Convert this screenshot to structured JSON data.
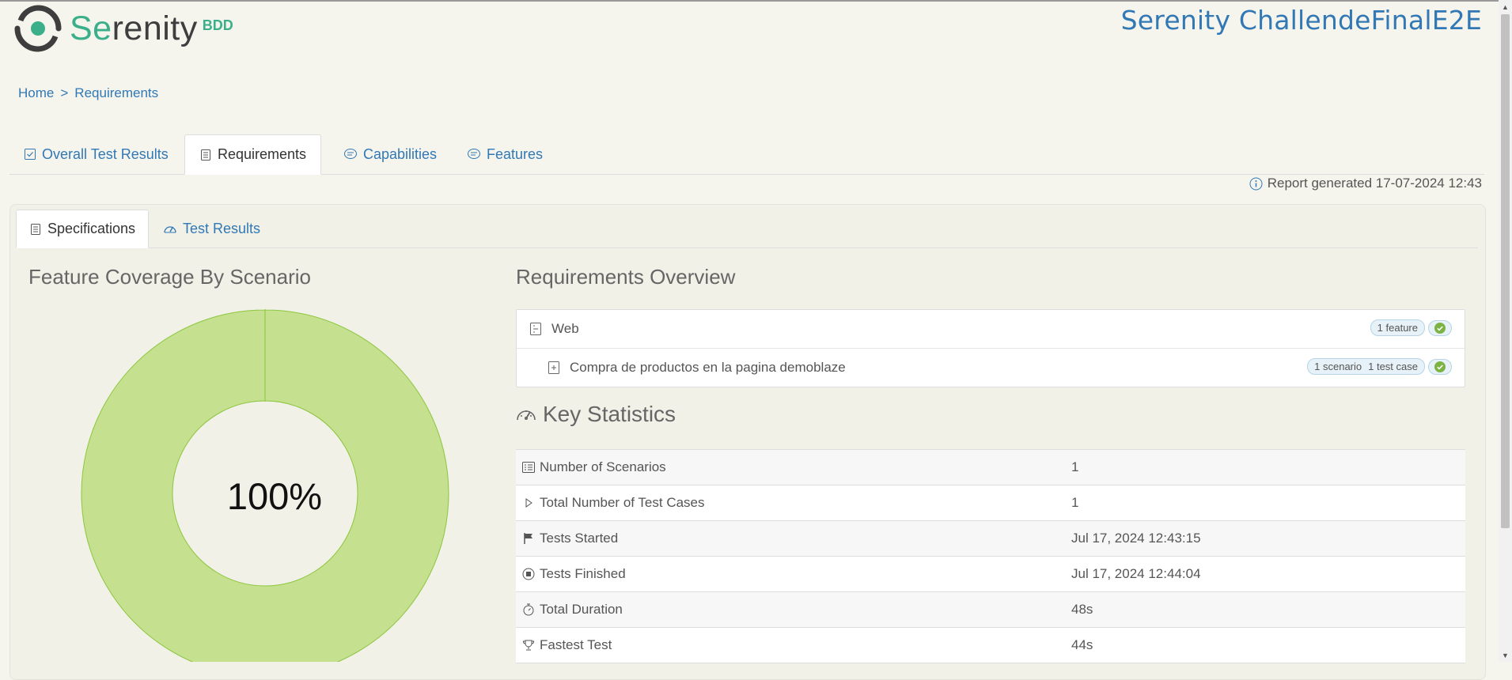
{
  "brand": {
    "logo_text_1": "Se",
    "logo_text_2": "renity",
    "logo_suffix": "BDD",
    "project_title": "Serenity ChallendeFinalE2E",
    "accent": "#3aaf8a"
  },
  "breadcrumb": {
    "home": "Home",
    "separator": ">",
    "current": "Requirements"
  },
  "main_tabs": [
    {
      "label": "Overall Test Results",
      "icon": "checklist-icon"
    },
    {
      "label": "Requirements",
      "icon": "document-icon",
      "active": true
    },
    {
      "label": "Capabilities",
      "icon": "comment-icon"
    },
    {
      "label": "Features",
      "icon": "comment-icon"
    }
  ],
  "report_generated": "Report generated 17-07-2024 12:43",
  "sub_tabs": [
    {
      "label": "Specifications",
      "icon": "document-icon",
      "active": true
    },
    {
      "label": "Test Results",
      "icon": "gauge-icon"
    }
  ],
  "coverage": {
    "title": "Feature Coverage By Scenario",
    "percent_label": "100%",
    "passed_fraction": 1.0,
    "color": "#c5e08e"
  },
  "requirements": {
    "title": "Requirements Overview",
    "rows": [
      {
        "label": "Web",
        "badges": [
          "1 feature"
        ],
        "status": "passed"
      },
      {
        "label": "Compra de productos en la pagina demoblaze",
        "badges": [
          "1 scenario",
          "1 test case"
        ],
        "status": "passed"
      }
    ]
  },
  "key_statistics": {
    "title": "Key Statistics",
    "rows": [
      {
        "label": "Number of Scenarios",
        "value": "1",
        "icon": "list-icon"
      },
      {
        "label": "Total Number of Test Cases",
        "value": "1",
        "icon": "play-icon"
      },
      {
        "label": "Tests Started",
        "value": "Jul 17, 2024 12:43:15",
        "icon": "flag-icon"
      },
      {
        "label": "Tests Finished",
        "value": "Jul 17, 2024 12:44:04",
        "icon": "stop-icon"
      },
      {
        "label": "Total Duration",
        "value": "48s",
        "icon": "stopwatch-icon"
      },
      {
        "label": "Fastest Test",
        "value": "44s",
        "icon": "trophy-icon"
      }
    ]
  }
}
